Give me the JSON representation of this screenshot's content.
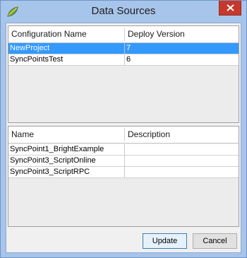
{
  "window": {
    "title": "Data Sources",
    "app_icon": "leaf-icon",
    "close_icon": "close-icon"
  },
  "configurations": {
    "columns": [
      "Configuration Name",
      "Deploy Version"
    ],
    "rows": [
      {
        "name": "NewProject",
        "version": "7",
        "selected": true
      },
      {
        "name": "SyncPointsTest",
        "version": "6",
        "selected": false
      }
    ]
  },
  "data_sources": {
    "columns": [
      "Name",
      "Description"
    ],
    "rows": [
      {
        "name": "SyncPoint1_BrightExample",
        "description": ""
      },
      {
        "name": "SyncPoint3_ScriptOnline",
        "description": ""
      },
      {
        "name": "SyncPoint3_ScriptRPC",
        "description": ""
      }
    ]
  },
  "buttons": {
    "update": "Update",
    "cancel": "Cancel"
  },
  "colors": {
    "selection": "#3399ff",
    "titlebar": "#a7c4ea",
    "close": "#c7382c"
  }
}
